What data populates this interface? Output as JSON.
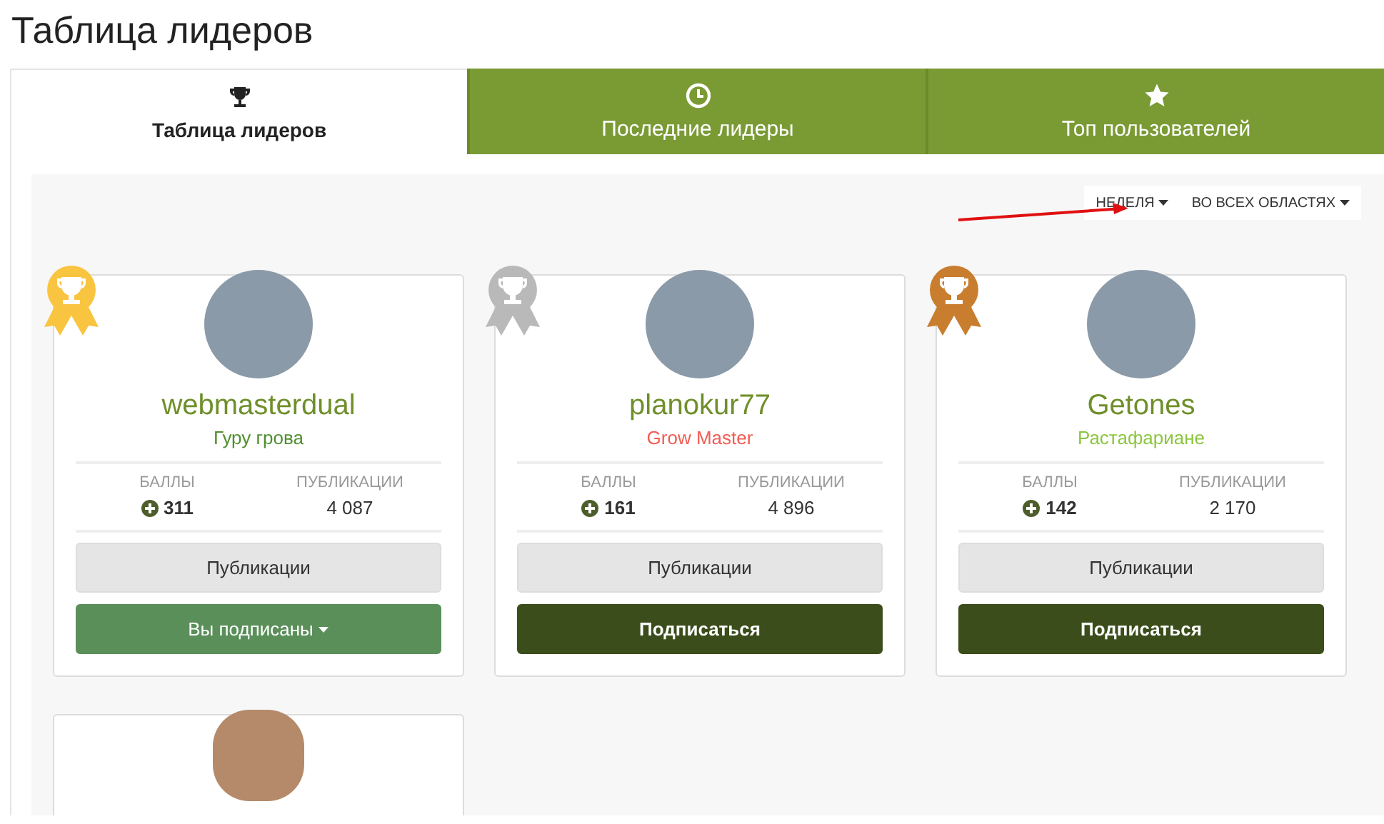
{
  "page_title": "Таблица лидеров",
  "tabs": [
    {
      "label": "Таблица лидеров",
      "selected": true
    },
    {
      "label": "Последние лидеры",
      "selected": false
    },
    {
      "label": "Топ пользователей",
      "selected": false
    }
  ],
  "filters": [
    {
      "label": "НЕДЕЛЯ"
    },
    {
      "label": "ВО ВСЕХ ОБЛАСТЯХ"
    }
  ],
  "cards": [
    {
      "kind": "full",
      "username": "webmasterdual",
      "rank": {
        "text": "Гуру грова",
        "color": "#4f8f2f"
      },
      "points_label": "БАЛЛЫ",
      "points": "311",
      "posts_label": "ПУБЛИКАЦИИ",
      "posts": "4 087",
      "posts_button": "Публикации",
      "follow_button": "Вы подписаны",
      "subscribed": true
    },
    {
      "kind": "full",
      "username": "planokur77",
      "rank": {
        "text": "Grow Master",
        "color": "#f25c54"
      },
      "points_label": "БАЛЛЫ",
      "points": "161",
      "posts_label": "ПУБЛИКАЦИИ",
      "posts": "4 896",
      "posts_button": "Публикации",
      "follow_button": "Подписаться",
      "subscribed": false
    },
    {
      "kind": "full",
      "username": "Getones",
      "rank": {
        "text": "Растафариане",
        "color": "#8cc63f"
      },
      "points_label": "БАЛЛЫ",
      "points": "142",
      "posts_label": "ПУБЛИКАЦИИ",
      "posts": "2 170",
      "posts_button": "Публикации",
      "follow_button": "Подписаться",
      "subscribed": false
    },
    {
      "kind": "partial"
    }
  ]
}
